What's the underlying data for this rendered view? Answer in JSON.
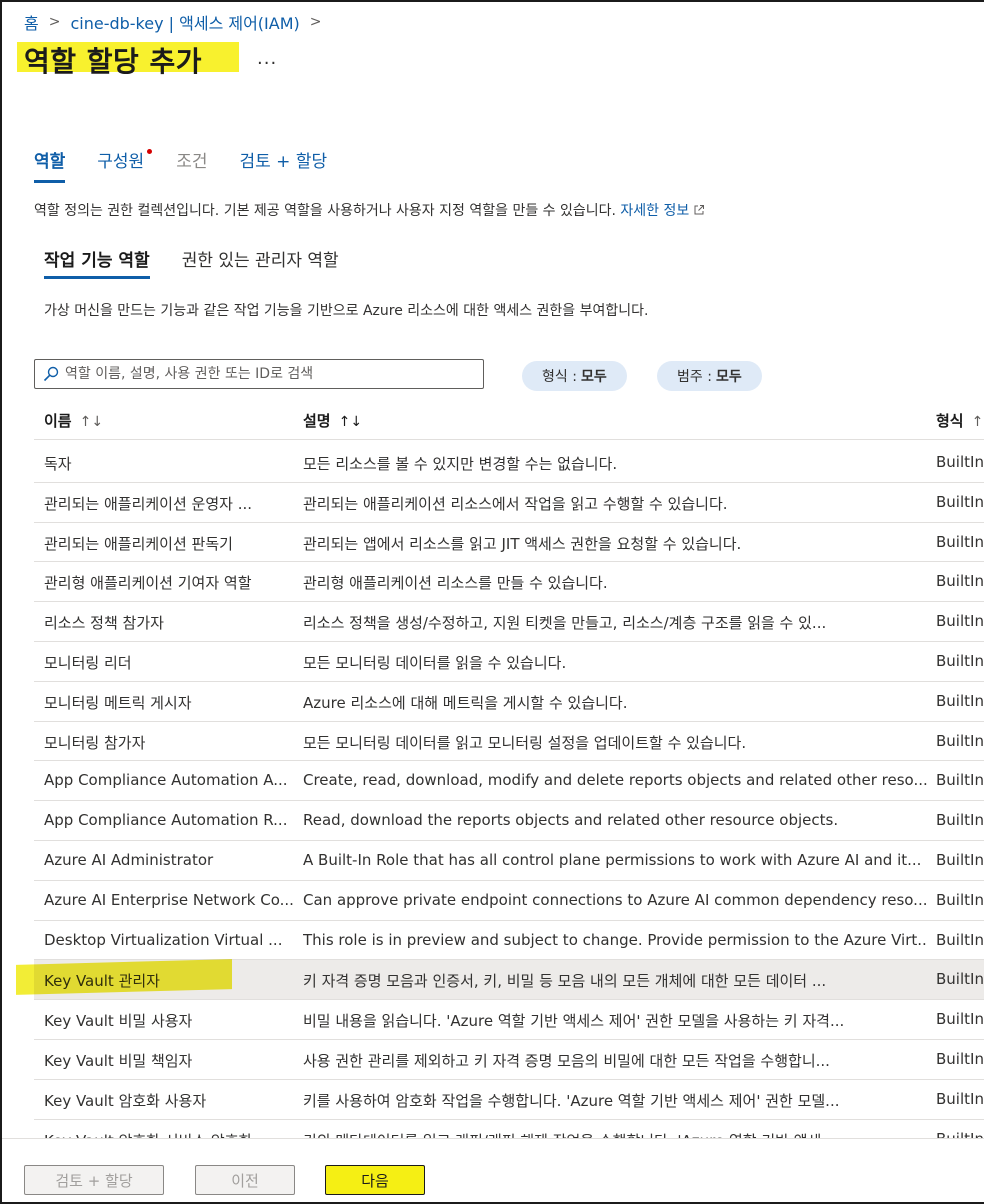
{
  "breadcrumb": {
    "home": "홈",
    "resource": "cine-db-key | 액세스 제어(IAM)"
  },
  "page_title": "역할 할당 추가",
  "more_label": "...",
  "tabs": [
    {
      "label": "역할"
    },
    {
      "label": "구성원"
    },
    {
      "label": "조건"
    },
    {
      "label": "검토 + 할당"
    }
  ],
  "description": "역할 정의는 권한 컬렉션입니다. 기본 제공 역할을 사용하거나 사용자 지정 역할을 만들 수 있습니다.",
  "learn_more": "자세한 정보",
  "subtabs": [
    {
      "label": "작업 기능 역할"
    },
    {
      "label": "권한 있는 관리자 역할"
    }
  ],
  "sub_description": "가상 머신을 만드는 기능과 같은 작업 기능을 기반으로 Azure 리소스에 대한 액세스 권한을 부여합니다.",
  "search": {
    "placeholder": "역할 이름, 설명, 사용 권한 또는 ID로 검색"
  },
  "filters": [
    {
      "label": "형식 :",
      "value": "모두"
    },
    {
      "label": "범주 :",
      "value": "모두"
    }
  ],
  "table": {
    "headers": [
      "이름",
      "설명",
      "형식"
    ],
    "sort_icon": "↑↓",
    "rows": [
      {
        "name": "독자",
        "desc": "모든 리소스를 볼 수 있지만 변경할 수는 없습니다.",
        "type": "BuiltInRole"
      },
      {
        "name": "관리되는 애플리케이션 운영자 ...",
        "desc": "관리되는 애플리케이션 리소스에서 작업을 읽고 수행할 수 있습니다.",
        "type": "BuiltInRole"
      },
      {
        "name": "관리되는 애플리케이션 판독기",
        "desc": "관리되는 앱에서 리소스를 읽고 JIT 액세스 권한을 요청할 수 있습니다.",
        "type": "BuiltInRole"
      },
      {
        "name": "관리형 애플리케이션 기여자 역할",
        "desc": "관리형 애플리케이션 리소스를 만들 수 있습니다.",
        "type": "BuiltInRole"
      },
      {
        "name": "리소스 정책 참가자",
        "desc": "리소스 정책을 생성/수정하고, 지원 티켓을 만들고, 리소스/계층 구조를 읽을 수 있...",
        "type": "BuiltInRole"
      },
      {
        "name": "모니터링 리더",
        "desc": "모든 모니터링 데이터를 읽을 수 있습니다.",
        "type": "BuiltInRole"
      },
      {
        "name": "모니터링 메트릭 게시자",
        "desc": "Azure 리소스에 대해 메트릭을 게시할 수 있습니다.",
        "type": "BuiltInRole"
      },
      {
        "name": "모니터링 참가자",
        "desc": "모든 모니터링 데이터를 읽고 모니터링 설정을 업데이트할 수 있습니다.",
        "type": "BuiltInRole"
      },
      {
        "name": "App Compliance Automation A...",
        "desc": "Create, read, download, modify and delete reports objects and related other reso...",
        "type": "BuiltInRole"
      },
      {
        "name": "App Compliance Automation R...",
        "desc": "Read, download the reports objects and related other resource objects.",
        "type": "BuiltInRole"
      },
      {
        "name": "Azure AI Administrator",
        "desc": "A Built-In Role that has all control plane permissions to work with Azure AI and it...",
        "type": "BuiltInRole"
      },
      {
        "name": "Azure AI Enterprise Network Co...",
        "desc": "Can approve private endpoint connections to Azure AI common dependency reso...",
        "type": "BuiltInRole"
      },
      {
        "name": "Desktop Virtualization Virtual ...",
        "desc": "This role is in preview and subject to change. Provide permission to the Azure Virt...",
        "type": "BuiltInRole"
      },
      {
        "name": "Key Vault 관리자",
        "desc": "키 자격 증명 모음과 인증서, 키, 비밀 등 모음 내의 모든 개체에 대한 모든 데이터 ...",
        "type": "BuiltInRole"
      },
      {
        "name": "Key Vault 비밀 사용자",
        "desc": "비밀 내용을 읽습니다. 'Azure 역할 기반 액세스 제어' 권한 모델을 사용하는 키 자격...",
        "type": "BuiltInRole"
      },
      {
        "name": "Key Vault 비밀 책임자",
        "desc": "사용 권한 관리를 제외하고 키 자격 증명 모음의 비밀에 대한 모든 작업을 수행합니...",
        "type": "BuiltInRole"
      },
      {
        "name": "Key Vault 암호화 사용자",
        "desc": "키를 사용하여 암호화 작업을 수행합니다. 'Azure 역할 기반 액세스 제어' 권한 모델...",
        "type": "BuiltInRole"
      },
      {
        "name": "Key Vault 암호화 서비스 암호화 ...",
        "desc": "키의 메타데이터를 읽고 래핑/래핑 해제 작업을 수행합니다. 'Azure 역할 기반 액세...",
        "type": "BuiltInRole"
      }
    ]
  },
  "footer": {
    "review_assign": "검토 + 할당",
    "previous": "이전",
    "next": "다음"
  },
  "colors": {
    "accent": "#0f5ea8",
    "highlight": "#f5ef14"
  }
}
